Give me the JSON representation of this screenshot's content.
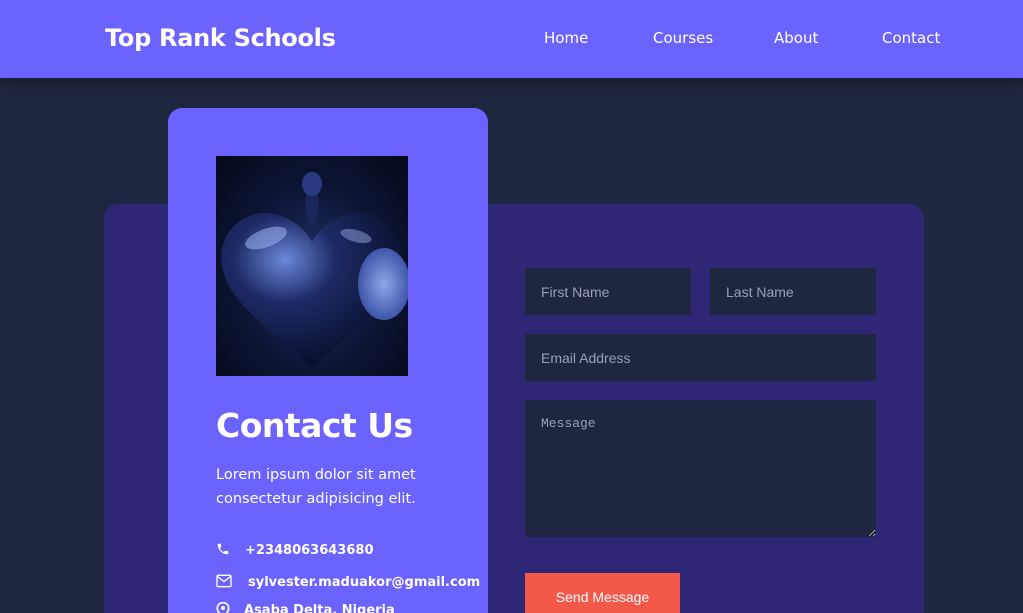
{
  "nav": {
    "brand": "Top Rank Schools",
    "links": [
      "Home",
      "Courses",
      "About",
      "Contact"
    ]
  },
  "contact_card": {
    "title": "Contact Us",
    "description": "Lorem ipsum dolor sit amet consectetur adipisicing elit.",
    "phone": "+2348063643680",
    "email": "sylvester.maduakor@gmail.com",
    "location": "Asaba Delta, Nigeria",
    "icons": [
      "phone-icon",
      "envelope-icon",
      "map-pin-icon"
    ]
  },
  "form": {
    "first_name_placeholder": "First Name",
    "last_name_placeholder": "Last Name",
    "email_placeholder": "Email Address",
    "message_placeholder": "Message",
    "submit_label": "Send Message"
  },
  "colors": {
    "accent": "#6c63ff",
    "page_background": "#1f2640",
    "panel_background": "#2e2775",
    "button": "#f2594b"
  }
}
